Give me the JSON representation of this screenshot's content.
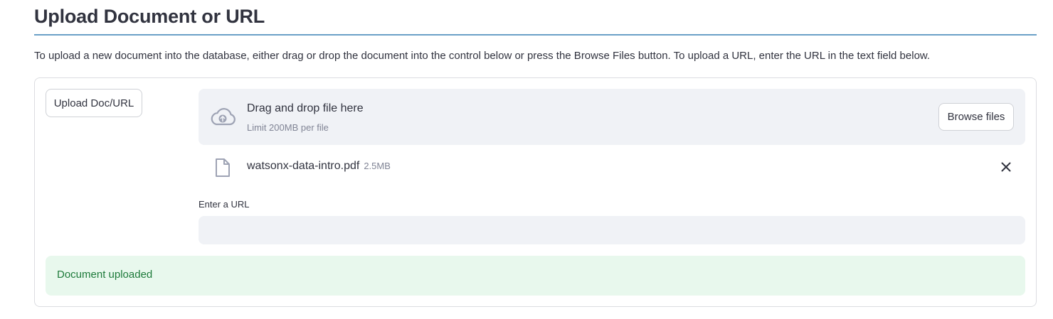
{
  "header": {
    "title": "Upload Document or URL",
    "intro": "To upload a new document into the database, either drag or drop the document into the control below or press the Browse Files button. To upload a URL, enter the URL in the text field below."
  },
  "form": {
    "upload_button_label": "Upload Doc/URL",
    "dropzone": {
      "icon": "cloud-upload-icon",
      "title": "Drag and drop file here",
      "limit": "Limit 200MB per file",
      "browse_label": "Browse files"
    },
    "uploaded_file": {
      "icon": "file-icon",
      "name": "watsonx-data-intro.pdf",
      "size": "2.5MB",
      "remove_icon": "close-icon"
    },
    "url_field": {
      "label": "Enter a URL",
      "value": ""
    },
    "status": {
      "message": "Document uploaded",
      "color": "#1d7a3a",
      "background": "#e8f8ed"
    }
  },
  "colors": {
    "accent_rule": "#6aa0c7",
    "panel_bg": "#f0f2f6",
    "text": "#31333f",
    "muted": "#808495"
  }
}
